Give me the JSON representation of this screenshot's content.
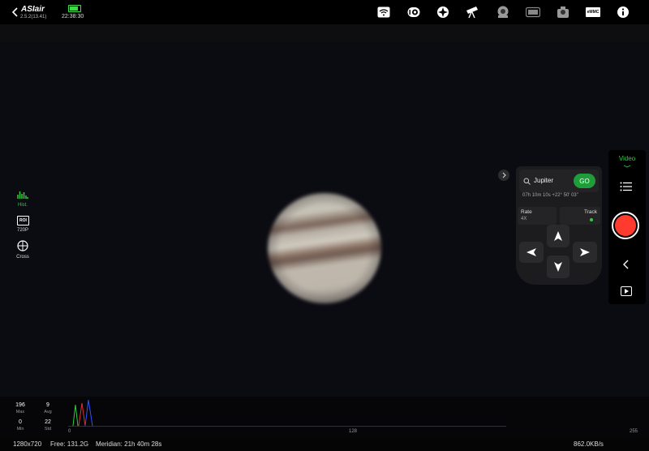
{
  "top": {
    "back_icon": "chevron-left-icon",
    "app_name": "ASIair",
    "version": "2.5.2(13.41)",
    "time": "22:38:30",
    "battery_color": "#3ddc47",
    "icons": [
      "wifi-icon",
      "hdd-icon",
      "compass-icon",
      "telescope-icon",
      "focuser-icon",
      "filter-wheel-icon",
      "camera-icon",
      "emmc-icon",
      "info-icon"
    ],
    "emmc_label": "eMMC"
  },
  "left_tools": [
    {
      "icon": "histogram-icon",
      "label": "Hist.",
      "active": true
    },
    {
      "icon": "roi-icon",
      "glyph": "ROI",
      "label": "720P",
      "active": false
    },
    {
      "icon": "crosshair-icon",
      "label": "Cross",
      "active": false
    }
  ],
  "target_panel": {
    "search_value": "Jupiter",
    "go_label": "GO",
    "coords": "07h 10m 10s +22° 50' 03\"",
    "rate_label": "Rate",
    "rate_value": "4X",
    "track_label": "Track",
    "collapse_icon": "chevron-right-icon"
  },
  "right_rail": {
    "mode_label": "Video",
    "mode_color": "#2ecc40",
    "record_color": "#ff3b30"
  },
  "histogram": {
    "max_value": "196",
    "max_label": "Max",
    "avg_value": "9",
    "avg_label": "Avg",
    "min_value": "0",
    "min_label": "Min",
    "std_value": "22",
    "std_label": "Std",
    "axis_ticks": [
      "0",
      "128",
      "255"
    ]
  },
  "status": {
    "resolution": "1280x720",
    "free": "Free: 131.2G",
    "meridian": "Meridian: 21h 40m 28s",
    "speed": "862.0KB/s"
  }
}
